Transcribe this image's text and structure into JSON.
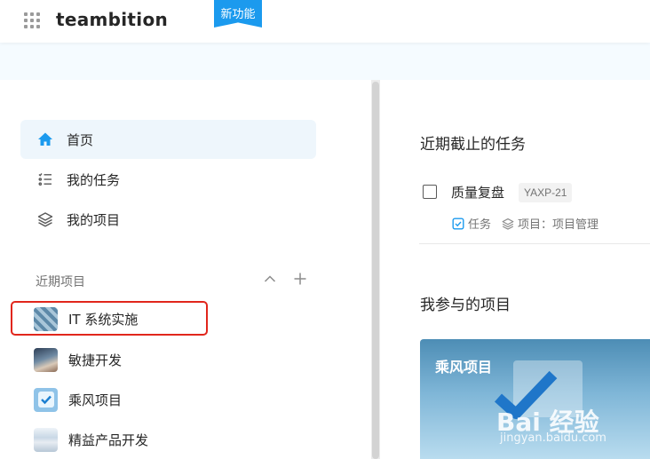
{
  "header": {
    "brand": "teambition",
    "new_badge": "新功能"
  },
  "sidebar": {
    "nav": [
      {
        "label": "首页",
        "icon": "home-icon",
        "active": true
      },
      {
        "label": "我的任务",
        "icon": "checklist-icon"
      },
      {
        "label": "我的项目",
        "icon": "layers-icon"
      }
    ],
    "recent_label": "近期项目",
    "recent_projects": [
      {
        "label": "IT 系统实施"
      },
      {
        "label": "敏捷开发"
      },
      {
        "label": "乘风项目"
      },
      {
        "label": "精益产品开发"
      }
    ]
  },
  "main": {
    "due_title": "近期截止的任务",
    "task": {
      "title": "质量复盘",
      "code": "YAXP-21",
      "type": "任务",
      "project": "项目：项目管理"
    },
    "joined_title": "我参与的项目",
    "card": {
      "title": "乘风项目"
    },
    "watermark": {
      "text": "Bai 经验",
      "url": "jingyan.baidu.com"
    }
  },
  "colors": {
    "accent": "#1b9aee",
    "active_bg": "#eef6fc",
    "highlight": "#e1261c"
  }
}
